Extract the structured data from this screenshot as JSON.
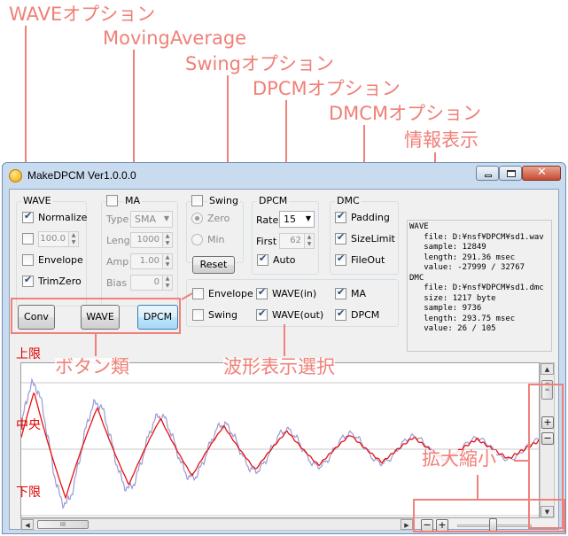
{
  "callouts": {
    "wave_option": "WAVEオプション",
    "moving_average": "MovingAverage",
    "swing_option": "Swingオプション",
    "dpcm_option": "DPCMオプション",
    "dmcm_option": "DMCMオプション",
    "info_display": "情報表示",
    "buttons": "ボタン類",
    "waveform_select": "波形表示選択",
    "zoom": "拡大縮小"
  },
  "window": {
    "title": "MakeDPCM Ver1.0.0.0"
  },
  "wave_group": {
    "label": "WAVE",
    "normalize_label": "Normalize",
    "normalize_checked": true,
    "level_checked": false,
    "level_value": "100.0",
    "envelope_label": "Envelope",
    "envelope_checked": false,
    "trimzero_label": "TrimZero",
    "trimzero_checked": true
  },
  "ma_group": {
    "label": "MA",
    "ma_checked": false,
    "type_label": "Type",
    "type_value": "SMA",
    "leng_label": "Leng",
    "leng_value": "1000",
    "amp_label": "Amp",
    "amp_value": "1.00",
    "bias_label": "Bias",
    "bias_value": "0"
  },
  "swing_group": {
    "label": "Swing",
    "swing_checked": false,
    "zero_label": "Zero",
    "zero_selected": true,
    "min_label": "Min",
    "min_selected": false,
    "reset_label": "Reset"
  },
  "dpcm_group": {
    "label": "DPCM",
    "rate_label": "Rate",
    "rate_value": "15",
    "first_label": "First",
    "first_value": "62",
    "auto_label": "Auto",
    "auto_checked": true
  },
  "dmc_group": {
    "label": "DMC",
    "padding_label": "Padding",
    "padding_checked": true,
    "sizelimit_label": "SizeLimit",
    "sizelimit_checked": true,
    "fileout_label": "FileOut",
    "fileout_checked": true
  },
  "info": {
    "text": "WAVE\n   file: D:¥nsf¥DPCM¥sd1.wav\n   sample: 12849\n   length: 291.36 msec\n   value: -27999 / 32767\nDMC\n   file: D:¥nsf¥DPCM¥sd1.dmc\n   size: 1217 byte\n   sample: 9736\n   length: 293.75 msec\n   value: 26 / 105"
  },
  "buttons": {
    "conv": "Conv",
    "wave": "WAVE",
    "dpcm": "DPCM"
  },
  "display_select": {
    "envelope_label": "Envelope",
    "envelope_checked": false,
    "swing_label": "Swing",
    "swing_checked": false,
    "wave_in_label": "WAVE(in)",
    "wave_in_checked": true,
    "wave_out_label": "WAVE(out)",
    "wave_out_checked": true,
    "ma_label": "MA",
    "ma_checked": true,
    "dpcm_label": "DPCM",
    "dpcm_checked": true
  },
  "wave_view": {
    "upper_label": "上限",
    "center_label": "中央",
    "lower_label": "下限",
    "colors": {
      "wave_in": "#9a9ad6",
      "dpcm": "#e81010",
      "gridline": "#c8c8c8"
    }
  },
  "scroll": {
    "thumb_label": "III"
  },
  "zoom_controls": {
    "minus": "−",
    "plus": "+"
  }
}
